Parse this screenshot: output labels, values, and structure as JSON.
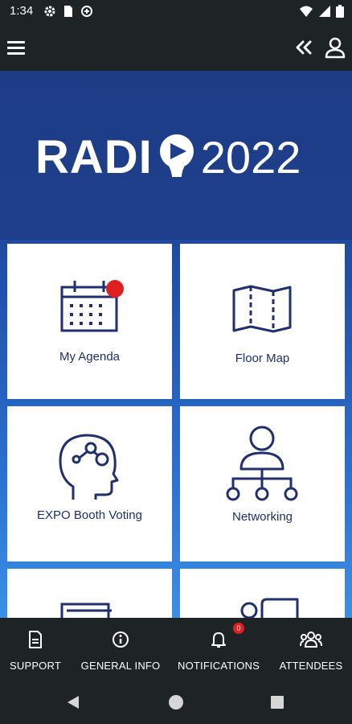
{
  "status_bar": {
    "time": "1:34",
    "left_icons": [
      "gear-icon",
      "sim-card-icon",
      "data-saver-icon"
    ],
    "right_icons": [
      "wifi-icon",
      "signal-icon",
      "battery-icon"
    ]
  },
  "app_bar": {
    "menu_icon": "hamburger-menu-icon",
    "collapse_icon": "double-chevron-left-icon",
    "profile_icon": "user-profile-icon"
  },
  "banner": {
    "logo_text_left": "RADI",
    "logo_text_right": "2022",
    "background": "#1f3f8d"
  },
  "tiles": [
    {
      "label": "My Agenda",
      "icon": "calendar-icon",
      "has_notification_dot": true
    },
    {
      "label": "Floor Map",
      "icon": "map-icon"
    },
    {
      "label": "EXPO Booth Voting",
      "icon": "head-brain-icon"
    },
    {
      "label": "Networking",
      "icon": "network-person-icon"
    },
    {
      "label": "",
      "icon": "documents-icon"
    },
    {
      "label": "",
      "icon": "chat-person-icon"
    }
  ],
  "bottom_nav": {
    "items": [
      {
        "label": "SUPPORT",
        "icon": "document-icon"
      },
      {
        "label": "GENERAL INFO",
        "icon": "info-icon"
      },
      {
        "label": "NOTIFICATIONS",
        "icon": "bell-icon",
        "badge": "0"
      },
      {
        "label": "ATTENDEES",
        "icon": "people-group-icon"
      }
    ]
  },
  "colors": {
    "accent_dark": "#1f2f6f",
    "badge_red": "#e02020",
    "bar_bg": "#1e2326"
  }
}
